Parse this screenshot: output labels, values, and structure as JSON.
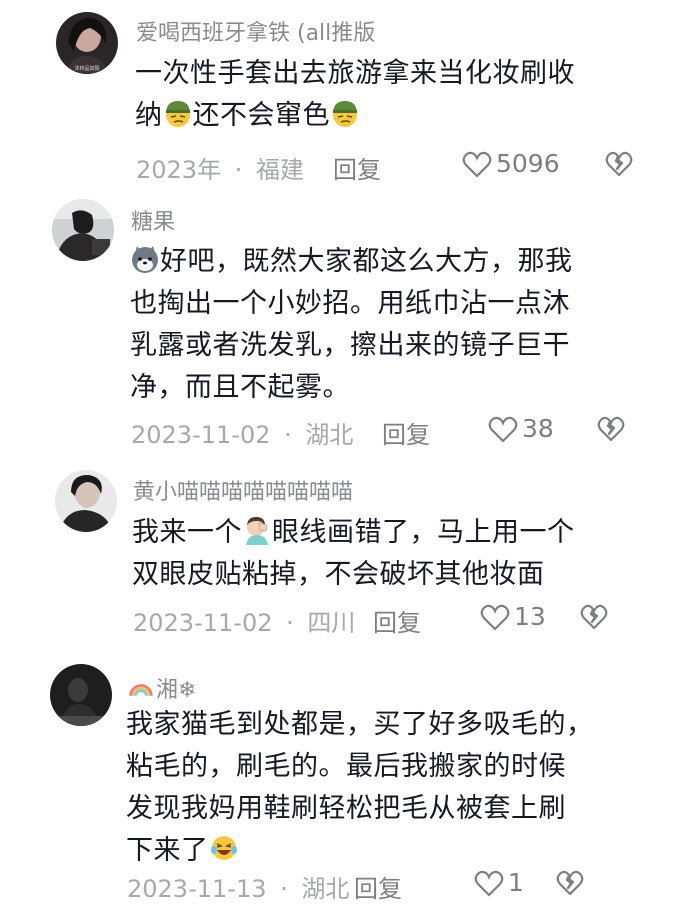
{
  "comments": [
    {
      "username": "爱喝西班牙拿铁 (all推版",
      "text_line1": "一次性手套出去旅游拿来当化妆刷收",
      "text_line2_a": "纳",
      "text_line2_b": "还不会窜色",
      "date": "2023年",
      "location": "福建",
      "reply_label": "回复",
      "likes": "5096",
      "avatar_caption": "沐林品如阳"
    },
    {
      "username": "糖果",
      "text_line1": "好吧，既然大家都这么大方，那我",
      "text_line2": "也掏出一个小妙招。用纸巾沾一点沐",
      "text_line3": "乳露或者洗发乳，擦出来的镜子巨干",
      "text_line4": "净，而且不起雾。",
      "date": "2023-11-02",
      "location": "湖北",
      "reply_label": "回复",
      "likes": "38"
    },
    {
      "username": "黄小喵喵喵喵喵喵喵喵",
      "text_line1_a": "我来一个",
      "text_line1_b": "眼线画错了，马上用一个",
      "text_line2": "双眼皮贴粘掉，不会破坏其他妆面",
      "date": "2023-11-02",
      "location": "四川",
      "reply_label": "回复",
      "likes": "13"
    },
    {
      "username": "湘❄",
      "text_line1": "我家猫毛到处都是，买了好多吸毛的，",
      "text_line2": "粘毛的，刷毛的。最后我搬家的时候",
      "text_line3": "发现我妈用鞋刷轻松把毛从被套上刷",
      "text_line4": "下来了",
      "date": "2023-11-13",
      "location": "湖北",
      "reply_label": "回复",
      "likes": "1"
    }
  ],
  "separator": "·",
  "icons": {
    "like": "heart-outline-icon",
    "dislike": "broken-heart-icon",
    "emoji_smirk": "smirk-helmet-emoji",
    "emoji_doge": "doge-emoji",
    "emoji_facepalm": "facepalm-emoji",
    "emoji_laugh": "laughing-tears-emoji",
    "rainbow": "rainbow-icon"
  },
  "colors": {
    "text": "#161823",
    "meta": "#a7a8ad",
    "username": "#8a8b91"
  }
}
